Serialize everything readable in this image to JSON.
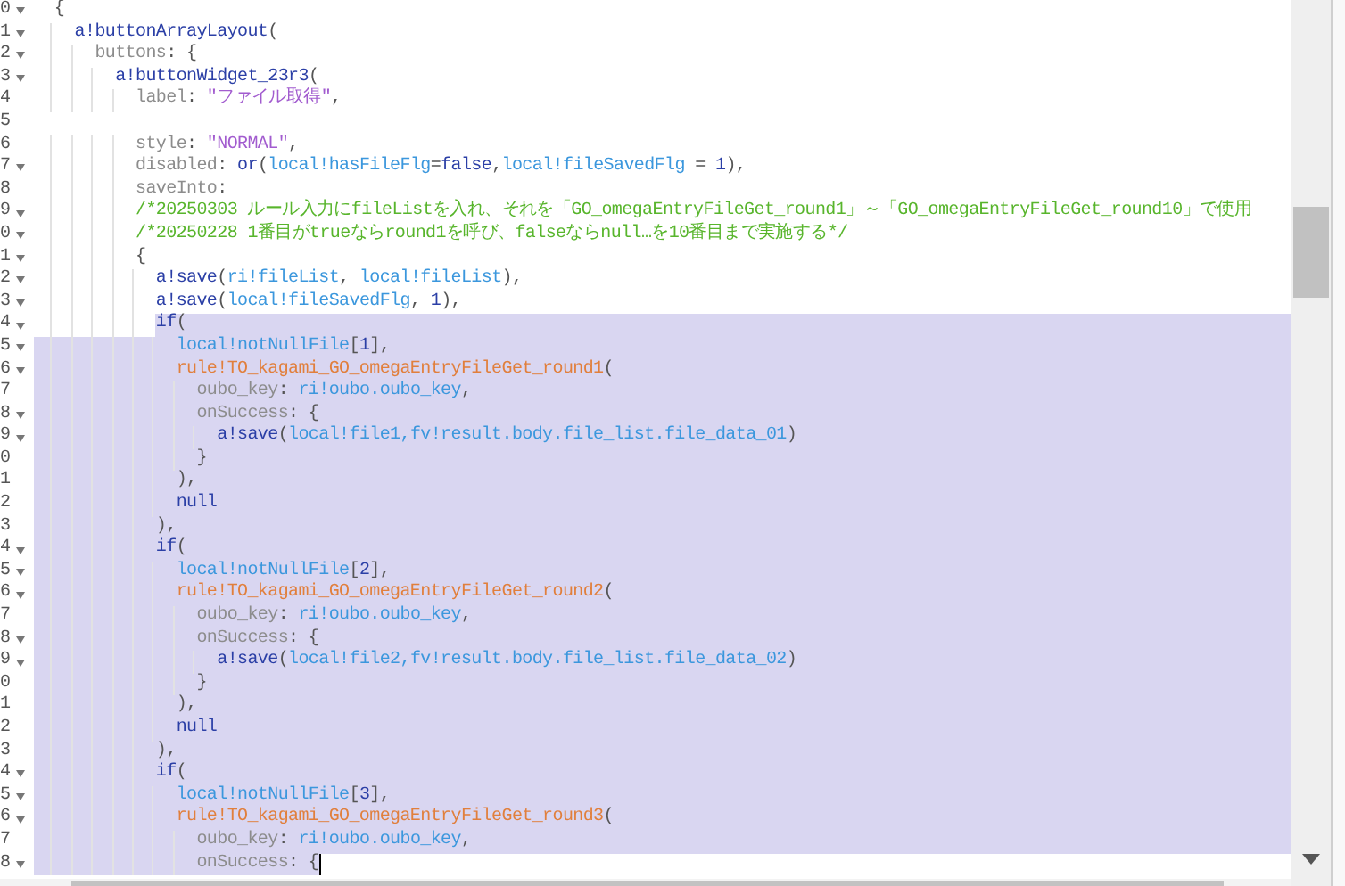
{
  "editor": {
    "lines": [
      {
        "number": "0",
        "foldable": true,
        "selected": false,
        "cursor": false,
        "tokens": [
          {
            "text": "  {",
            "kind": "punct"
          }
        ]
      },
      {
        "number": "1",
        "foldable": true,
        "selected": false,
        "cursor": false,
        "tokens": [
          {
            "text": "    a!buttonArrayLayout",
            "kind": "fn"
          },
          {
            "text": "(",
            "kind": "punct"
          }
        ]
      },
      {
        "number": "2",
        "foldable": true,
        "selected": false,
        "cursor": false,
        "tokens": [
          {
            "text": "      buttons",
            "kind": "prop"
          },
          {
            "text": ": {",
            "kind": "punct"
          }
        ]
      },
      {
        "number": "3",
        "foldable": true,
        "selected": false,
        "cursor": false,
        "tokens": [
          {
            "text": "        a!buttonWidget_23r3",
            "kind": "fn"
          },
          {
            "text": "(",
            "kind": "punct"
          }
        ]
      },
      {
        "number": "4",
        "foldable": false,
        "selected": false,
        "cursor": false,
        "tokens": [
          {
            "text": "          label",
            "kind": "prop"
          },
          {
            "text": ": ",
            "kind": "punct"
          },
          {
            "text": "\"ファイル取得\"",
            "kind": "str"
          },
          {
            "text": ",",
            "kind": "punct"
          }
        ]
      },
      {
        "number": "5",
        "foldable": false,
        "selected": false,
        "cursor": false
      },
      {
        "number": "6",
        "foldable": false,
        "selected": false,
        "cursor": false,
        "tokens": [
          {
            "text": "          style",
            "kind": "prop"
          },
          {
            "text": ": ",
            "kind": "punct"
          },
          {
            "text": "\"NORMAL\"",
            "kind": "str"
          },
          {
            "text": ",",
            "kind": "punct"
          }
        ]
      },
      {
        "number": "7",
        "foldable": true,
        "selected": false,
        "cursor": false,
        "tokens": [
          {
            "text": "          disabled",
            "kind": "prop"
          },
          {
            "text": ": ",
            "kind": "punct"
          },
          {
            "text": "or",
            "kind": "fn"
          },
          {
            "text": "(",
            "kind": "punct"
          },
          {
            "text": "local!hasFileFlg",
            "kind": "var"
          },
          {
            "text": "=",
            "kind": "punct"
          },
          {
            "text": "false",
            "kind": "fn"
          },
          {
            "text": ",",
            "kind": "punct"
          },
          {
            "text": "local!fileSavedFlg",
            "kind": "var"
          },
          {
            "text": " = ",
            "kind": "punct"
          },
          {
            "text": "1",
            "kind": "num"
          },
          {
            "text": "),",
            "kind": "punct"
          }
        ]
      },
      {
        "number": "8",
        "foldable": false,
        "selected": false,
        "cursor": false,
        "tokens": [
          {
            "text": "          saveInto",
            "kind": "prop"
          },
          {
            "text": ":",
            "kind": "punct"
          }
        ]
      },
      {
        "number": "9",
        "foldable": true,
        "selected": false,
        "cursor": false,
        "tokens": [
          {
            "text": "          /*20250303 ルール入力にfileListを入れ、それを「GO_omegaEntryFileGet_round1」～「GO_omegaEntryFileGet_round10」で使用",
            "kind": "comment"
          }
        ]
      },
      {
        "number": "0",
        "foldable": true,
        "selected": false,
        "cursor": false,
        "tokens": [
          {
            "text": "          /*20250228 1番目がtrueならround1を呼び、falseならnull…を10番目まで実施する*/",
            "kind": "comment"
          }
        ]
      },
      {
        "number": "1",
        "foldable": true,
        "selected": false,
        "cursor": false,
        "tokens": [
          {
            "text": "          {",
            "kind": "punct"
          }
        ]
      },
      {
        "number": "2",
        "foldable": true,
        "selected": false,
        "cursor": false,
        "tokens": [
          {
            "text": "            a!save",
            "kind": "fn"
          },
          {
            "text": "(",
            "kind": "punct"
          },
          {
            "text": "ri!fileList",
            "kind": "var"
          },
          {
            "text": ", ",
            "kind": "punct"
          },
          {
            "text": "local!fileList",
            "kind": "var"
          },
          {
            "text": "),",
            "kind": "punct"
          }
        ]
      },
      {
        "number": "3",
        "foldable": true,
        "selected": false,
        "cursor": false,
        "tokens": [
          {
            "text": "            a!save",
            "kind": "fn"
          },
          {
            "text": "(",
            "kind": "punct"
          },
          {
            "text": "local!fileSavedFlg",
            "kind": "var"
          },
          {
            "text": ", ",
            "kind": "punct"
          },
          {
            "text": "1",
            "kind": "num"
          },
          {
            "text": "),",
            "kind": "punct"
          }
        ]
      },
      {
        "number": "4",
        "foldable": true,
        "selected": true,
        "cursor": false,
        "tokens": [
          {
            "text": "            if",
            "kind": "fn"
          },
          {
            "text": "(",
            "kind": "punct"
          }
        ]
      },
      {
        "number": "5",
        "foldable": true,
        "selected": true,
        "cursor": false,
        "tokens": [
          {
            "text": "              local!notNullFile",
            "kind": "var"
          },
          {
            "text": "[",
            "kind": "punct"
          },
          {
            "text": "1",
            "kind": "num"
          },
          {
            "text": "],",
            "kind": "punct"
          }
        ]
      },
      {
        "number": "6",
        "foldable": true,
        "selected": true,
        "cursor": false,
        "tokens": [
          {
            "text": "              rule!TO_kagami_GO_omegaEntryFileGet_round1",
            "kind": "rule"
          },
          {
            "text": "(",
            "kind": "punct"
          }
        ]
      },
      {
        "number": "7",
        "foldable": false,
        "selected": true,
        "cursor": false,
        "tokens": [
          {
            "text": "                oubo_key",
            "kind": "prop"
          },
          {
            "text": ": ",
            "kind": "punct"
          },
          {
            "text": "ri!oubo.oubo_key",
            "kind": "var"
          },
          {
            "text": ",",
            "kind": "punct"
          }
        ]
      },
      {
        "number": "8",
        "foldable": true,
        "selected": true,
        "cursor": false,
        "tokens": [
          {
            "text": "                onSuccess",
            "kind": "prop"
          },
          {
            "text": ": {",
            "kind": "punct"
          }
        ]
      },
      {
        "number": "9",
        "foldable": true,
        "selected": true,
        "cursor": false,
        "tokens": [
          {
            "text": "                  a!save",
            "kind": "fn"
          },
          {
            "text": "(",
            "kind": "punct"
          },
          {
            "text": "local!file1,fv!result.body.file_list.file_data_01",
            "kind": "var"
          },
          {
            "text": ")",
            "kind": "punct"
          }
        ]
      },
      {
        "number": "0",
        "foldable": false,
        "selected": true,
        "cursor": false,
        "tokens": [
          {
            "text": "                }",
            "kind": "punct"
          }
        ]
      },
      {
        "number": "1",
        "foldable": false,
        "selected": true,
        "cursor": false,
        "tokens": [
          {
            "text": "              ),",
            "kind": "punct"
          }
        ]
      },
      {
        "number": "2",
        "foldable": false,
        "selected": true,
        "cursor": false,
        "tokens": [
          {
            "text": "              null",
            "kind": "fn"
          }
        ]
      },
      {
        "number": "3",
        "foldable": false,
        "selected": true,
        "cursor": false,
        "tokens": [
          {
            "text": "            ),",
            "kind": "punct"
          }
        ]
      },
      {
        "number": "4",
        "foldable": true,
        "selected": true,
        "cursor": false,
        "tokens": [
          {
            "text": "            if",
            "kind": "fn"
          },
          {
            "text": "(",
            "kind": "punct"
          }
        ]
      },
      {
        "number": "5",
        "foldable": true,
        "selected": true,
        "cursor": false,
        "tokens": [
          {
            "text": "              local!notNullFile",
            "kind": "var"
          },
          {
            "text": "[",
            "kind": "punct"
          },
          {
            "text": "2",
            "kind": "num"
          },
          {
            "text": "],",
            "kind": "punct"
          }
        ]
      },
      {
        "number": "6",
        "foldable": true,
        "selected": true,
        "cursor": false,
        "tokens": [
          {
            "text": "              rule!TO_kagami_GO_omegaEntryFileGet_round2",
            "kind": "rule"
          },
          {
            "text": "(",
            "kind": "punct"
          }
        ]
      },
      {
        "number": "7",
        "foldable": false,
        "selected": true,
        "cursor": false,
        "tokens": [
          {
            "text": "                oubo_key",
            "kind": "prop"
          },
          {
            "text": ": ",
            "kind": "punct"
          },
          {
            "text": "ri!oubo.oubo_key",
            "kind": "var"
          },
          {
            "text": ",",
            "kind": "punct"
          }
        ]
      },
      {
        "number": "8",
        "foldable": true,
        "selected": true,
        "cursor": false,
        "tokens": [
          {
            "text": "                onSuccess",
            "kind": "prop"
          },
          {
            "text": ": {",
            "kind": "punct"
          }
        ]
      },
      {
        "number": "9",
        "foldable": true,
        "selected": true,
        "cursor": false,
        "tokens": [
          {
            "text": "                  a!save",
            "kind": "fn"
          },
          {
            "text": "(",
            "kind": "punct"
          },
          {
            "text": "local!file2,fv!result.body.file_list.file_data_02",
            "kind": "var"
          },
          {
            "text": ")",
            "kind": "punct"
          }
        ]
      },
      {
        "number": "0",
        "foldable": false,
        "selected": true,
        "cursor": false,
        "tokens": [
          {
            "text": "                }",
            "kind": "punct"
          }
        ]
      },
      {
        "number": "1",
        "foldable": false,
        "selected": true,
        "cursor": false,
        "tokens": [
          {
            "text": "              ),",
            "kind": "punct"
          }
        ]
      },
      {
        "number": "2",
        "foldable": false,
        "selected": true,
        "cursor": false,
        "tokens": [
          {
            "text": "              null",
            "kind": "fn"
          }
        ]
      },
      {
        "number": "3",
        "foldable": false,
        "selected": true,
        "cursor": false,
        "tokens": [
          {
            "text": "            ),",
            "kind": "punct"
          }
        ]
      },
      {
        "number": "4",
        "foldable": true,
        "selected": true,
        "cursor": false,
        "tokens": [
          {
            "text": "            if",
            "kind": "fn"
          },
          {
            "text": "(",
            "kind": "punct"
          }
        ]
      },
      {
        "number": "5",
        "foldable": true,
        "selected": true,
        "cursor": false,
        "tokens": [
          {
            "text": "              local!notNullFile",
            "kind": "var"
          },
          {
            "text": "[",
            "kind": "punct"
          },
          {
            "text": "3",
            "kind": "num"
          },
          {
            "text": "],",
            "kind": "punct"
          }
        ]
      },
      {
        "number": "6",
        "foldable": true,
        "selected": true,
        "cursor": false,
        "tokens": [
          {
            "text": "              rule!TO_kagami_GO_omegaEntryFileGet_round3",
            "kind": "rule"
          },
          {
            "text": "(",
            "kind": "punct"
          }
        ]
      },
      {
        "number": "7",
        "foldable": false,
        "selected": true,
        "cursor": false,
        "tokens": [
          {
            "text": "                oubo_key",
            "kind": "prop"
          },
          {
            "text": ": ",
            "kind": "punct"
          },
          {
            "text": "ri!oubo.oubo_key",
            "kind": "var"
          },
          {
            "text": ",",
            "kind": "punct"
          }
        ]
      },
      {
        "number": "8",
        "foldable": true,
        "selected": true,
        "cursor": true,
        "tokens": [
          {
            "text": "                onSuccess",
            "kind": "prop"
          },
          {
            "text": ": {",
            "kind": "punct"
          }
        ]
      }
    ]
  }
}
